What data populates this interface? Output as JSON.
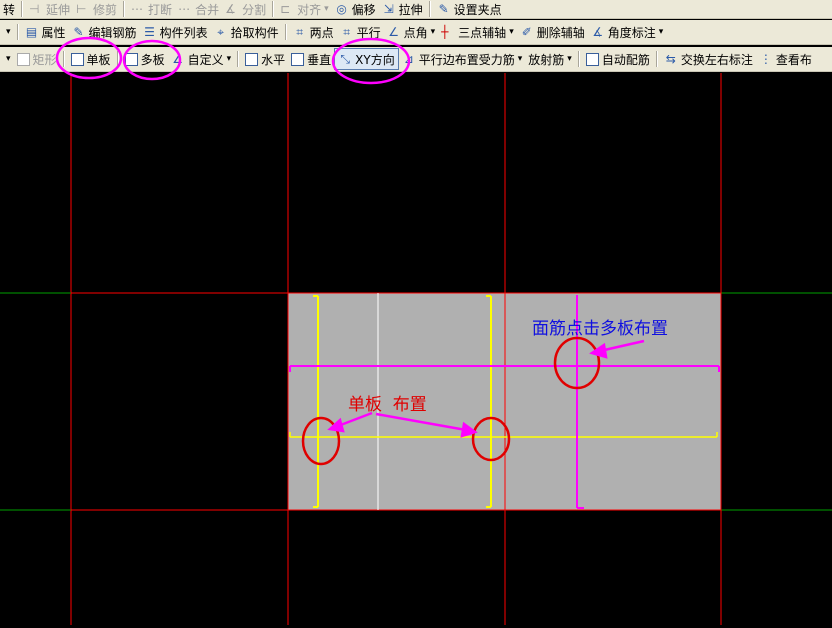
{
  "toolbar1": {
    "items": [
      "转",
      "延伸",
      "修剪",
      "打断",
      "合并",
      "分割",
      "对齐",
      "偏移",
      "拉伸",
      "设置夹点"
    ]
  },
  "toolbar2": {
    "items": [
      "属性",
      "编辑钢筋",
      "构件列表",
      "拾取构件",
      "两点",
      "平行",
      "点角",
      "三点辅轴",
      "删除辅轴",
      "角度标注"
    ]
  },
  "toolbar3": {
    "items": [
      "矩形",
      "单板",
      "多板",
      "自定义",
      "水平",
      "垂直",
      "XY方向",
      "平行边布置受力筋",
      "放射筋",
      "自动配筋",
      "交换左右标注",
      "查看布"
    ]
  },
  "annotations": {
    "multi_board": "面筋点击多板布置",
    "single_board": "单板  布置"
  },
  "colors": {
    "highlight": "#ff00ff",
    "circle": "#e00000",
    "grid": "#ff0000",
    "slab": "#b0b0b0",
    "rebar_yellow": "#ffff00"
  }
}
